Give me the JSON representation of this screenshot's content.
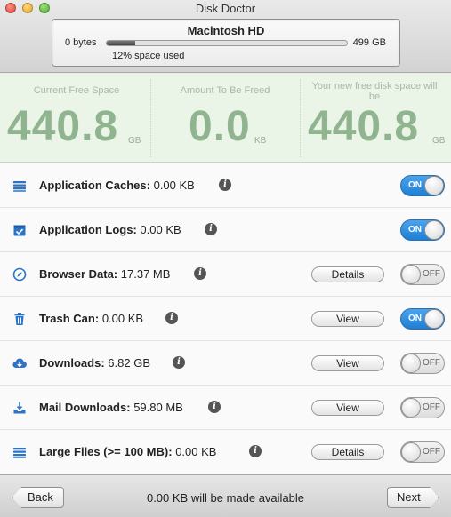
{
  "window": {
    "title": "Disk Doctor"
  },
  "disk": {
    "name": "Macintosh HD",
    "min_label": "0 bytes",
    "max_label": "499 GB",
    "used_text": "12% space used",
    "used_fraction": 0.12
  },
  "stats": {
    "current": {
      "label": "Current Free Space",
      "value": "440.8",
      "unit": "GB"
    },
    "freed": {
      "label": "Amount To Be Freed",
      "value": "0.0",
      "unit": "KB"
    },
    "new": {
      "label": "Your new free disk space will be",
      "value": "440.8",
      "unit": "GB"
    }
  },
  "items": [
    {
      "name": "Application Caches:",
      "value": "0.00 KB",
      "icon": "stack-icon",
      "button": "",
      "toggle": "ON"
    },
    {
      "name": "Application Logs:",
      "value": "0.00 KB",
      "icon": "calendar-check-icon",
      "button": "",
      "toggle": "ON"
    },
    {
      "name": "Browser Data:",
      "value": "17.37 MB",
      "icon": "compass-icon",
      "button": "Details",
      "toggle": "OFF"
    },
    {
      "name": "Trash Can:",
      "value": "0.00 KB",
      "icon": "trash-icon",
      "button": "View",
      "toggle": "ON"
    },
    {
      "name": "Downloads:",
      "value": "6.82 GB",
      "icon": "cloud-download-icon",
      "button": "View",
      "toggle": "OFF"
    },
    {
      "name": "Mail Downloads:",
      "value": "59.80 MB",
      "icon": "tray-download-icon",
      "button": "View",
      "toggle": "OFF"
    },
    {
      "name": "Large Files (>= 100 MB):",
      "value": "0.00 KB",
      "icon": "stack-icon",
      "button": "Details",
      "toggle": "OFF"
    }
  ],
  "footer": {
    "back_label": "Back",
    "next_label": "Next",
    "status": "0.00 KB will be made available"
  },
  "colors": {
    "accent": "#1f7fd6",
    "stats_bg": "#eaf4e7",
    "stats_value": "#8fb48f"
  }
}
